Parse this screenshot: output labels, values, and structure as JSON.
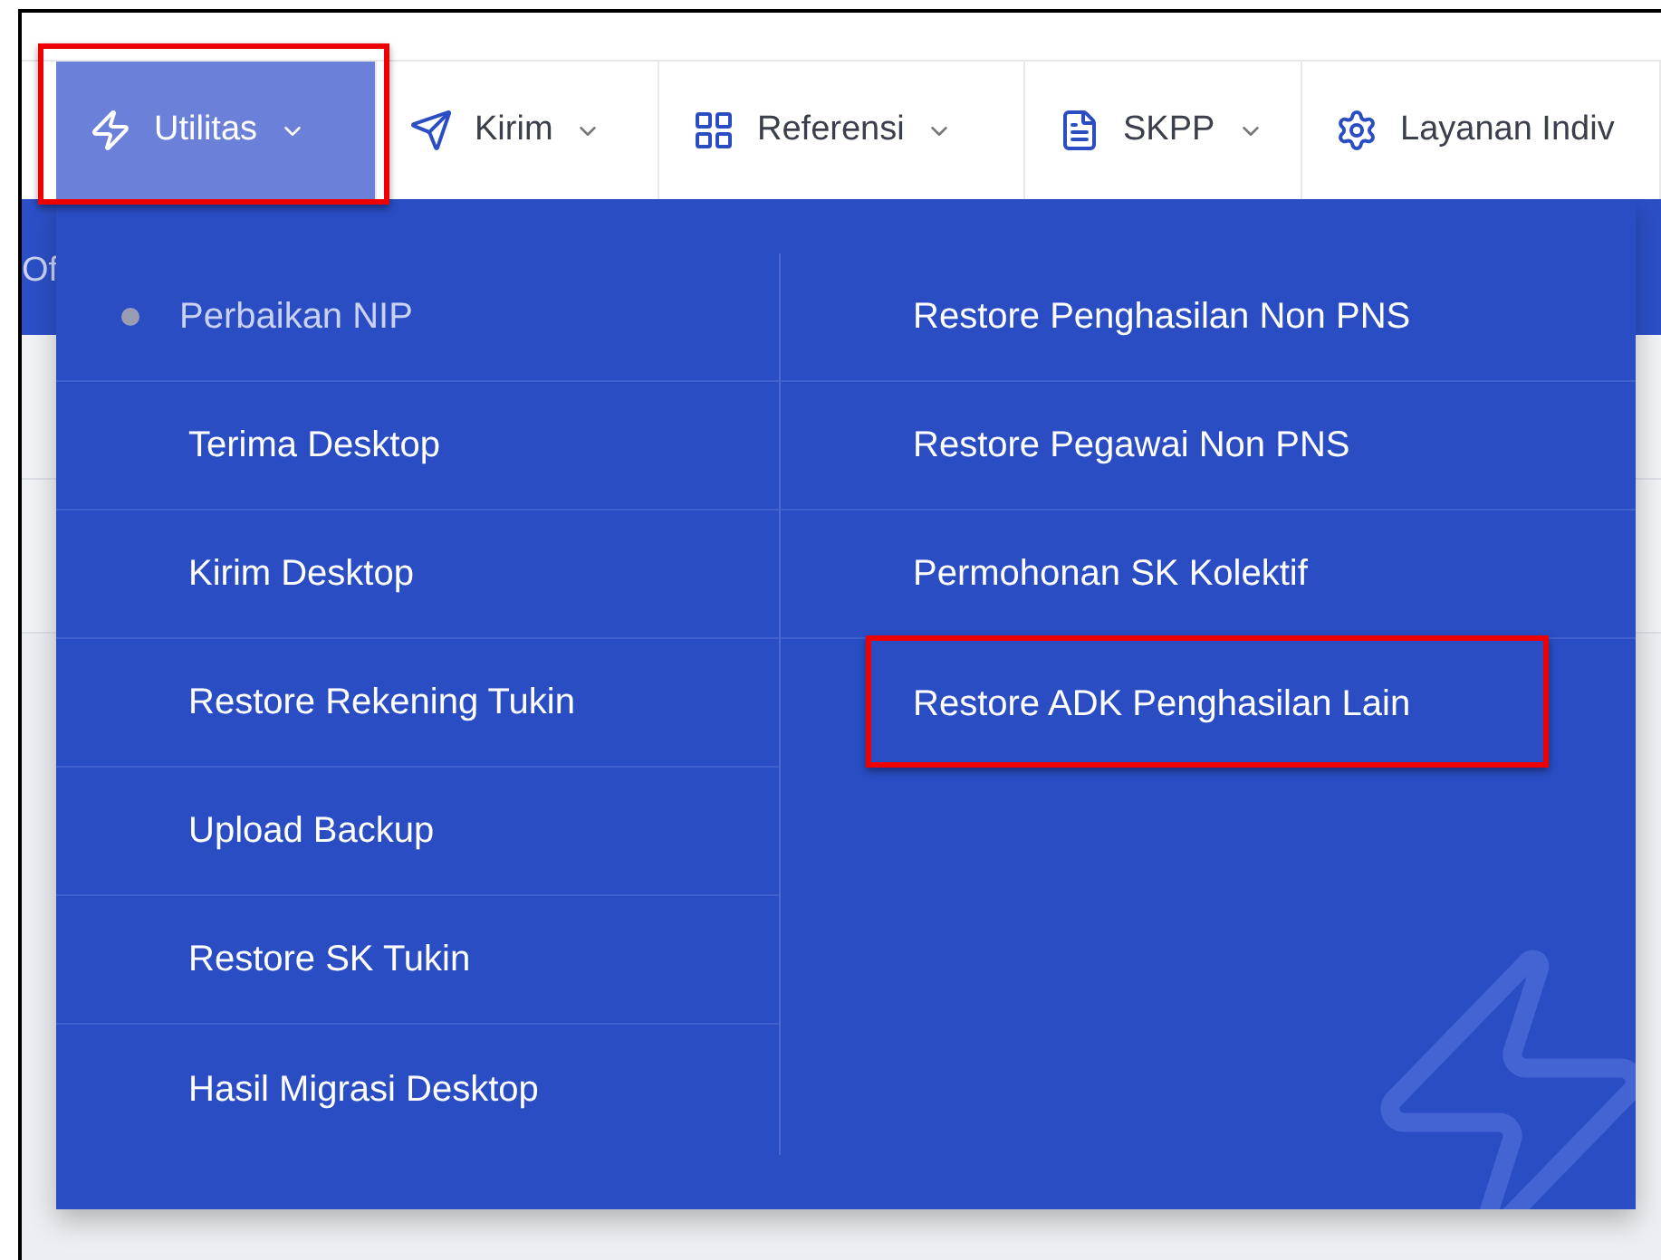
{
  "nav": {
    "tabs": [
      {
        "label": "Utilitas",
        "selected": true,
        "highlighted": true
      },
      {
        "label": "Kirim",
        "selected": false,
        "highlighted": false
      },
      {
        "label": "Referensi",
        "selected": false,
        "highlighted": false
      },
      {
        "label": "SKPP",
        "selected": false,
        "highlighted": false
      },
      {
        "label": "Layanan Indiv",
        "selected": false,
        "highlighted": false
      }
    ]
  },
  "page": {
    "heading": "Of"
  },
  "menu": {
    "columns": [
      [
        {
          "label": "Perbaikan NIP",
          "selected": true,
          "highlighted": false
        },
        {
          "label": "Terima Desktop",
          "selected": false,
          "highlighted": false
        },
        {
          "label": "Kirim Desktop",
          "selected": false,
          "highlighted": false
        },
        {
          "label": "Restore Rekening Tukin",
          "selected": false,
          "highlighted": false
        },
        {
          "label": "Upload Backup",
          "selected": false,
          "highlighted": false
        },
        {
          "label": "Restore SK Tukin",
          "selected": false,
          "highlighted": false
        },
        {
          "label": "Hasil Migrasi Desktop",
          "selected": false,
          "highlighted": false
        }
      ],
      [
        {
          "label": "Restore Penghasilan Non PNS",
          "selected": false,
          "highlighted": false
        },
        {
          "label": "Restore Pegawai Non PNS",
          "selected": false,
          "highlighted": false
        },
        {
          "label": "Permohonan SK Kolektif",
          "selected": false,
          "highlighted": false
        },
        {
          "label": "Restore ADK Penghasilan Lain",
          "selected": false,
          "highlighted": true
        }
      ]
    ]
  }
}
